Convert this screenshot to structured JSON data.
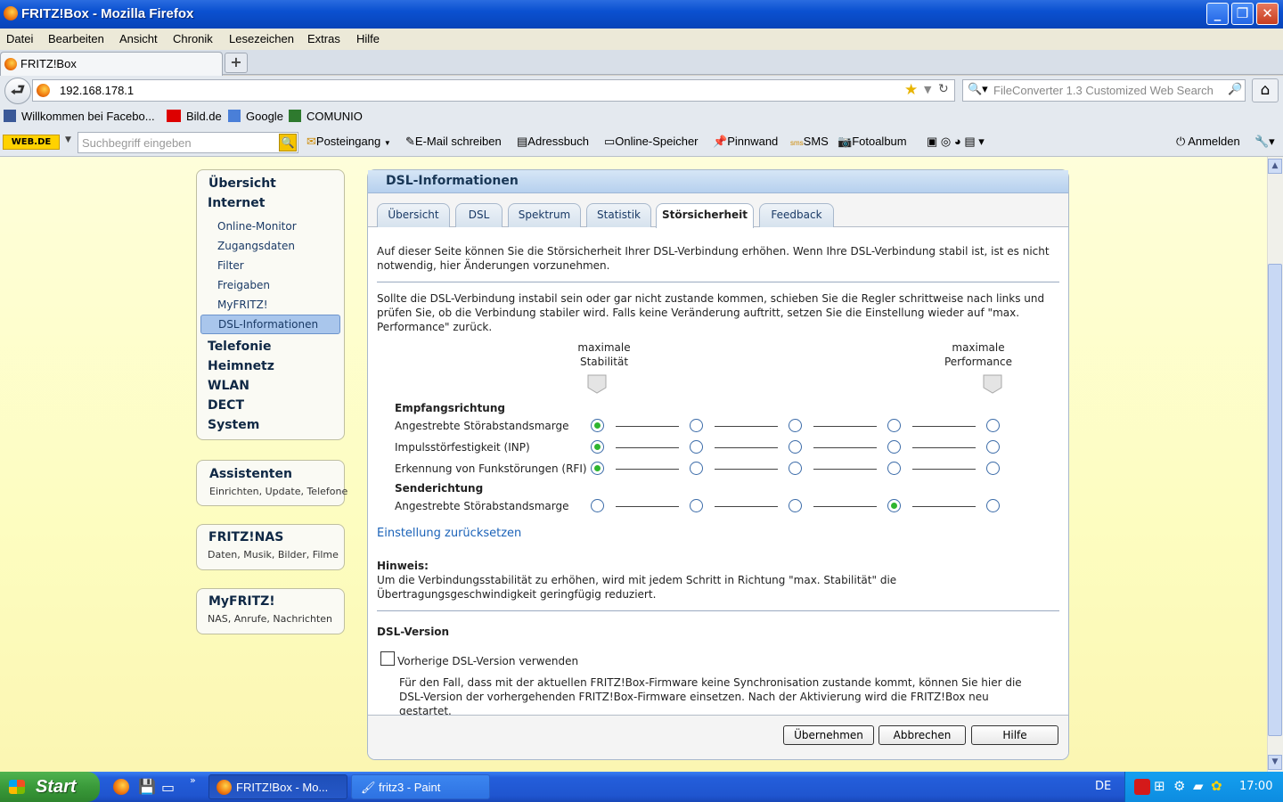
{
  "window": {
    "title": "FRITZ!Box - Mozilla Firefox"
  },
  "menu": [
    "Datei",
    "Bearbeiten",
    "Ansicht",
    "Chronik",
    "Lesezeichen",
    "Extras",
    "Hilfe"
  ],
  "tabs": [
    {
      "label": "FRITZ!Box"
    }
  ],
  "url": "192.168.178.1",
  "search": {
    "placeholder": "FileConverter 1.3 Customized Web Search"
  },
  "bookmarks": [
    "Willkommen bei Facebo...",
    "Bild.de",
    "Google",
    "COMUNIO"
  ],
  "webde": {
    "logo": "WEB.DE",
    "search_placeholder": "Suchbegriff eingeben",
    "items": [
      "Posteingang",
      "E-Mail schreiben",
      "Adressbuch",
      "Online-Speicher",
      "Pinnwand",
      "SMS",
      "Fotoalbum"
    ],
    "login": "Anmelden"
  },
  "sidebar": {
    "main": [
      "Übersicht",
      "Internet"
    ],
    "sub": [
      "Online-Monitor",
      "Zugangsdaten",
      "Filter",
      "Freigaben",
      "MyFRITZ!",
      "DSL-Informationen"
    ],
    "rest": [
      "Telefonie",
      "Heimnetz",
      "WLAN",
      "DECT",
      "System"
    ],
    "boxes": [
      {
        "title": "Assistenten",
        "sub": "Einrichten, Update, Telefone"
      },
      {
        "title": "FRITZ!NAS",
        "sub": "Daten, Musik, Bilder, Filme"
      },
      {
        "title": "MyFRITZ!",
        "sub": "NAS, Anrufe, Nachrichten"
      }
    ]
  },
  "content": {
    "title": "DSL-Informationen",
    "tabs": [
      "Übersicht",
      "DSL",
      "Spektrum",
      "Statistik",
      "Störsicherheit",
      "Feedback"
    ],
    "active_tab": "Störsicherheit",
    "intro1": "Auf dieser Seite können Sie die Störsicherheit Ihrer DSL-Verbindung erhöhen. Wenn Ihre DSL-Verbindung stabil ist, ist es nicht notwendig, hier Änderungen vorzunehmen.",
    "intro2": "Sollte die DSL-Verbindung instabil sein oder gar nicht zustande kommen, schieben Sie die Regler schrittweise nach links und prüfen Sie, ob die Verbindung stabiler wird. Falls keine Veränderung auftritt, setzen Sie die Einstellung wieder auf \"max. Performance\" zurück.",
    "left_label": "maximale Stabilität",
    "right_label": "maximale Performance",
    "section_rx": "Empfangsrichtung",
    "section_tx": "Senderichtung",
    "rows": [
      {
        "label": "Angestrebte Störabstandsmarge",
        "selected": 0
      },
      {
        "label": "Impulsstörfestigkeit (INP)",
        "selected": 0
      },
      {
        "label": "Erkennung von Funkstörungen (RFI)",
        "selected": 0
      },
      {
        "label": "Angestrebte Störabstandsmarge",
        "selected": 3
      }
    ],
    "reset_link": "Einstellung zurücksetzen",
    "hint_title": "Hinweis:",
    "hint_text": "Um die Verbindungsstabilität zu erhöhen, wird mit jedem Schritt in Richtung \"max. Stabilität\" die Übertragungsgeschwindigkeit geringfügig reduziert.",
    "dslver_title": "DSL-Version",
    "dslver_checkbox": "Vorherige DSL-Version verwenden",
    "dslver_text": "Für den Fall, dass mit der aktuellen FRITZ!Box-Firmware keine Synchronisation zustande kommt, können Sie hier die DSL-Version der vorhergehenden FRITZ!Box-Firmware einsetzen. Nach der Aktivierung wird die FRITZ!Box neu gestartet.",
    "buttons": [
      "Übernehmen",
      "Abbrechen",
      "Hilfe"
    ]
  },
  "taskbar": {
    "start": "Start",
    "tasks": [
      "FRITZ!Box - Mo...",
      "fritz3 - Paint"
    ],
    "lang": "DE",
    "time": "17:00"
  },
  "colors": {
    "selected_radio": "#2fb52f",
    "nav_selected": "#a9c6ec",
    "page_bg": "#fdfdc0"
  }
}
